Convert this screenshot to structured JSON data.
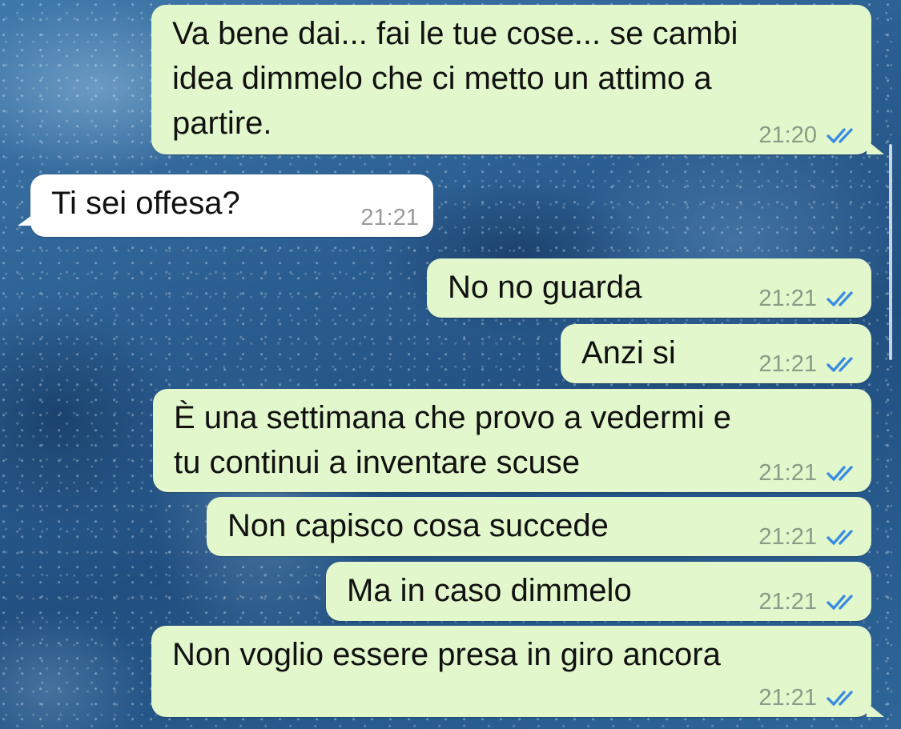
{
  "colors": {
    "outgoing_bubble": "#e2f7cb",
    "incoming_bubble": "#ffffff",
    "read_ticks": "#3b8de0",
    "timestamp_outgoing": "#8c9a86"
  },
  "messages": [
    {
      "direction": "outgoing",
      "text": "Va bene dai... fai le tue cose... se cambi\nidea dimmelo che ci metto un attimo a\npartire.",
      "time": "21:20",
      "status_icon": "double-check-read-icon"
    },
    {
      "direction": "incoming",
      "text": "Ti sei offesa?",
      "time": "21:21"
    },
    {
      "direction": "outgoing",
      "text": "No no guarda",
      "time": "21:21",
      "status_icon": "double-check-read-icon"
    },
    {
      "direction": "outgoing",
      "text": "Anzi si",
      "time": "21:21",
      "status_icon": "double-check-read-icon"
    },
    {
      "direction": "outgoing",
      "text": "È una settimana che provo a vedermi e\ntu continui a inventare scuse",
      "time": "21:21",
      "status_icon": "double-check-read-icon"
    },
    {
      "direction": "outgoing",
      "text": "Non capisco cosa succede",
      "time": "21:21",
      "status_icon": "double-check-read-icon"
    },
    {
      "direction": "outgoing",
      "text": "Ma in caso dimmelo",
      "time": "21:21",
      "status_icon": "double-check-read-icon"
    },
    {
      "direction": "outgoing",
      "text": "Non voglio essere presa in giro ancora",
      "time": "21:21",
      "status_icon": "double-check-read-icon"
    }
  ]
}
